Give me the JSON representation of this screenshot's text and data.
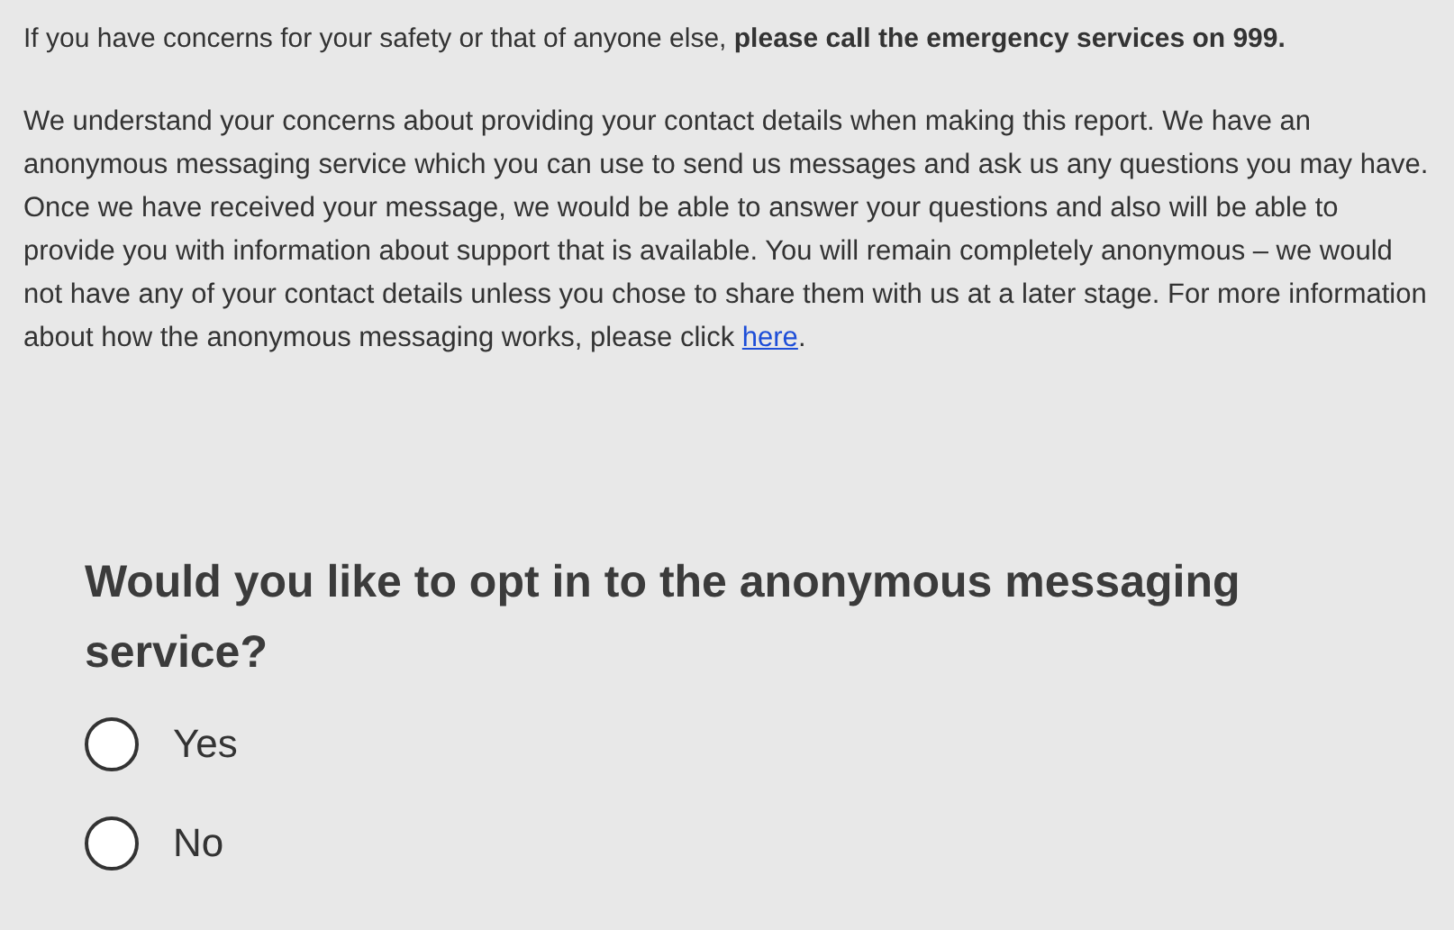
{
  "notice": "If you have concerns for your safety or that of anyone else, **please call the emergency services on 999.**",
  "info": {
    "text": "We understand your concerns about providing your contact details when making this report. We have an anonymous messaging service which you can use to send us messages and ask us any questions you may have. Once we have received your message, we would be able to answer your questions and also will be able to provide you with information about support that is available. You will remain completely anonymous – we would not have any of your contact details unless you chose to share them with us at a later stage. For more information about how the anonymous messaging works, please click ",
    "link": "here",
    "after": "."
  },
  "question": {
    "title": "Would you like to opt in to the anonymous messaging service?",
    "options": [
      {
        "label": "Yes",
        "selected": false
      },
      {
        "label": "No",
        "selected": false
      }
    ]
  }
}
